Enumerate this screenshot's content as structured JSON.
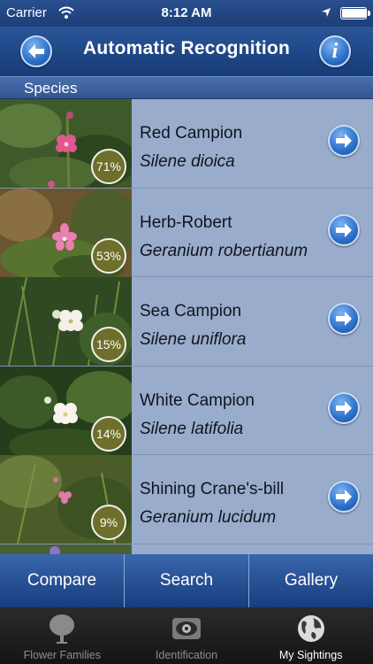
{
  "status_bar": {
    "carrier": "Carrier",
    "time": "8:12 AM",
    "battery_level": 0.95
  },
  "nav": {
    "title": "Automatic Recognition",
    "info_label": "i"
  },
  "section": {
    "title": "Species"
  },
  "species": [
    {
      "common": "Red Campion",
      "latin": "Silene dioica",
      "percent": "71%"
    },
    {
      "common": "Herb-Robert",
      "latin": "Geranium robertianum",
      "percent": "53%"
    },
    {
      "common": "Sea Campion",
      "latin": "Silene uniflora",
      "percent": "15%"
    },
    {
      "common": "White Campion",
      "latin": "Silene latifolia",
      "percent": "14%"
    },
    {
      "common": "Shining Crane's-bill",
      "latin": "Geranium lucidum",
      "percent": "9%"
    }
  ],
  "actions": {
    "compare": "Compare",
    "search": "Search",
    "gallery": "Gallery"
  },
  "tabs": [
    {
      "label": "Flower Families",
      "icon": "tree-icon",
      "active": false
    },
    {
      "label": "Identification",
      "icon": "eye-icon",
      "active": false
    },
    {
      "label": "My Sightings",
      "icon": "globe-icon",
      "active": true
    }
  ],
  "colors": {
    "nav_blue": "#1c3e78",
    "list_bg": "#9aaccb",
    "badge": "#6d6f2a"
  }
}
